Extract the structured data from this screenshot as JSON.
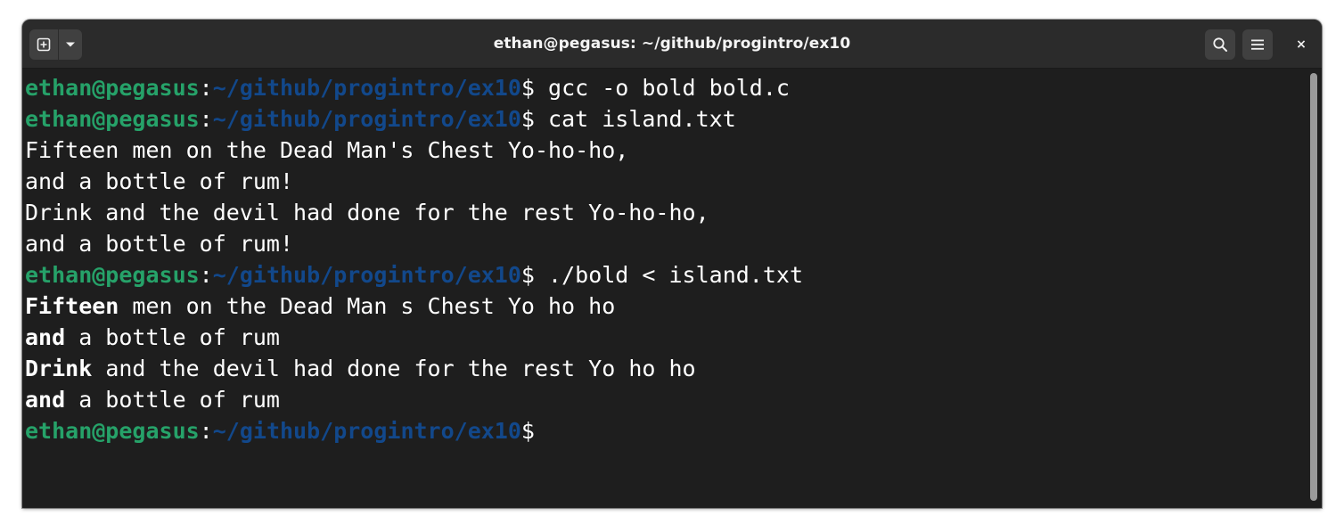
{
  "window": {
    "title": "ethan@pegasus: ~/github/progintro/ex10",
    "close_label": "×"
  },
  "toolbar": {
    "new_tab_icon": "new-tab-icon",
    "tab_menu_icon": "chevron-down-icon",
    "search_icon": "search-icon",
    "menu_icon": "hamburger-menu-icon",
    "close_icon": "close-icon"
  },
  "terminal": {
    "lines": [
      {
        "user": "ethan@pegasus",
        "sep": ":",
        "path": "~/github/progintro/ex10",
        "dollar": "$",
        "cmd": " gcc -o bold bold.c"
      },
      {
        "user": "ethan@pegasus",
        "sep": ":",
        "path": "~/github/progintro/ex10",
        "dollar": "$",
        "cmd": " cat island.txt"
      },
      {
        "text": "Fifteen men on the Dead Man's Chest Yo-ho-ho,"
      },
      {
        "text": "and a bottle of rum!"
      },
      {
        "text": "Drink and the devil had done for the rest Yo-ho-ho,"
      },
      {
        "text": "and a bottle of rum!"
      },
      {
        "user": "ethan@pegasus",
        "sep": ":",
        "path": "~/github/progintro/ex10",
        "dollar": "$",
        "cmd": " ./bold < island.txt"
      },
      {
        "bold": "Fifteen",
        "rest": " men on the Dead Man s Chest Yo ho ho"
      },
      {
        "bold": "and",
        "rest": " a bottle of rum"
      },
      {
        "bold": "Drink",
        "rest": " and the devil had done for the rest Yo ho ho"
      },
      {
        "bold": "and",
        "rest": " a bottle of rum"
      },
      {
        "user": "ethan@pegasus",
        "sep": ":",
        "path": "~/github/progintro/ex10",
        "dollar": "$",
        "cmd": ""
      }
    ]
  },
  "colors": {
    "background": "#1e1e1e",
    "headerbar": "#2b2b2b",
    "prompt_user": "#26a269",
    "prompt_path": "#12488b",
    "text": "#ffffff"
  }
}
